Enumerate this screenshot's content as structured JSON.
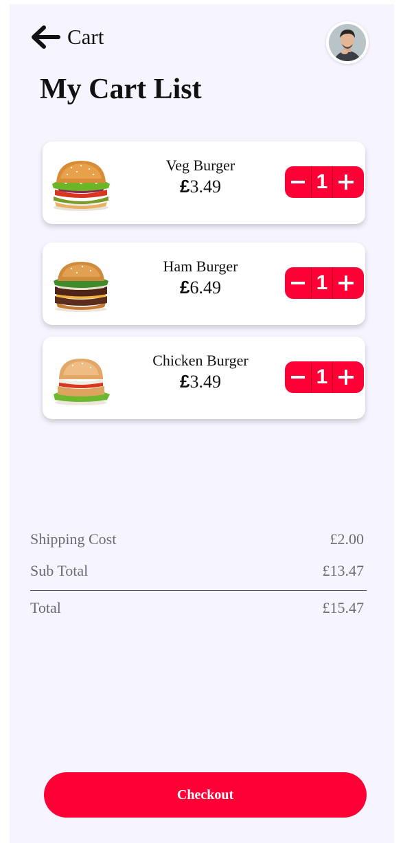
{
  "header": {
    "title": "Cart",
    "back_icon": "arrow-left-icon",
    "avatar_icon": "user-avatar"
  },
  "page_title": "My Cart List",
  "cart": {
    "items": [
      {
        "name": "Veg Burger",
        "currency": "£",
        "price": "3.49",
        "quantity": "1",
        "image": "veg-burger-image"
      },
      {
        "name": "Ham Burger",
        "currency": "£",
        "price": "6.49",
        "quantity": "1",
        "image": "ham-burger-image"
      },
      {
        "name": "Chicken Burger",
        "currency": "£",
        "price": "3.49",
        "quantity": "1",
        "image": "chicken-burger-image"
      }
    ],
    "decrease_icon": "minus-icon",
    "increase_icon": "plus-icon"
  },
  "summary": {
    "shipping_label": "Shipping Cost",
    "shipping_value": "£2.00",
    "subtotal_label": "Sub Total",
    "subtotal_value": "£13.47",
    "total_label": "Total",
    "total_value": "£15.47"
  },
  "checkout_label": "Checkout",
  "colors": {
    "accent": "#ff0036",
    "background": "#f6f5ff",
    "card": "#ffffff",
    "muted_text": "#6d6a78"
  }
}
